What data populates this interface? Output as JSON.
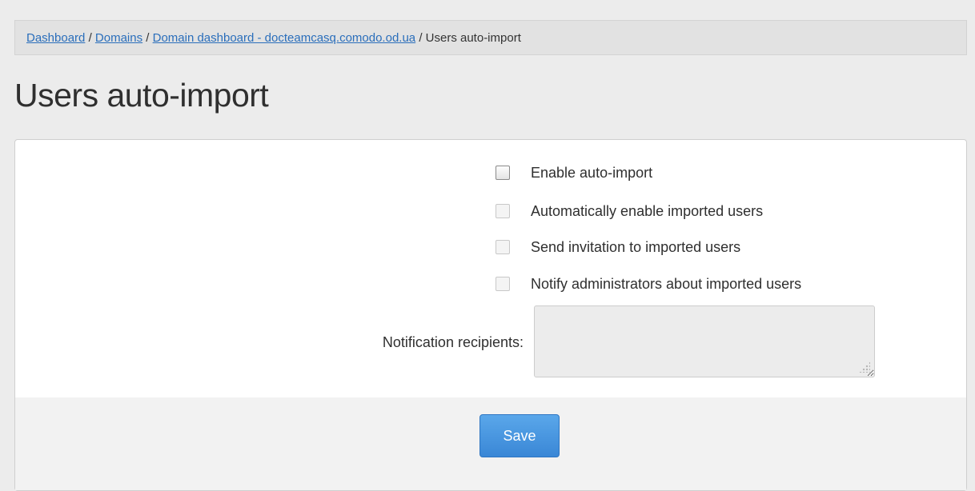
{
  "breadcrumb": {
    "items": [
      "Dashboard",
      "Domains",
      "Domain dashboard - docteamcasq.comodo.od.ua"
    ],
    "current": "Users auto-import",
    "separator": "/"
  },
  "page_title": "Users auto-import",
  "form": {
    "options": [
      {
        "label": "Enable auto-import",
        "checked": false,
        "enabled": true
      },
      {
        "label": "Automatically enable imported users",
        "checked": false,
        "enabled": false
      },
      {
        "label": "Send invitation to imported users",
        "checked": false,
        "enabled": false
      },
      {
        "label": "Notify administrators about imported users",
        "checked": false,
        "enabled": false
      }
    ],
    "notification_label": "Notification recipients:",
    "notification_value": ""
  },
  "footer": {
    "save_label": "Save"
  },
  "colors": {
    "link": "#2a6ebb",
    "primary_button": "#4a97e0",
    "page_background": "#ececec"
  }
}
